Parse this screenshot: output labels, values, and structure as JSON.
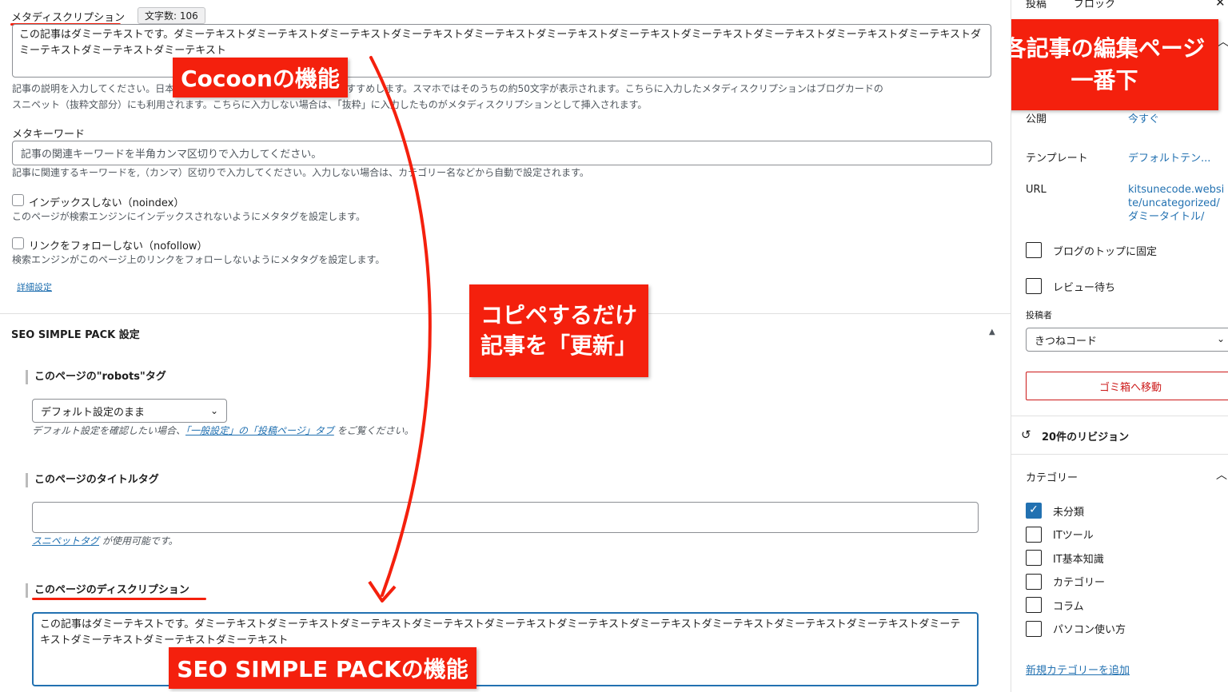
{
  "meta_description": {
    "label": "メタディスクリプション",
    "char_count": "文字数: 106",
    "value": "この記事はダミーテキストです。ダミーテキストダミーテキストダミーテキストダミーテキストダミーテキストダミーテキストダミーテキストダミーテキストダミーテキストダミーテキストダミーテキストダミーテキストダミーテキストダミーテキスト",
    "help_line1": "記事の説明を入力してください。日本語では、およそ120文字前後の入力をおすすめします。スマホではそのうちの約50文字が表示されます。こちらに入力したメタディスクリプションはブログカードの",
    "help_line2": "スニペット（抜粋文部分）にも利用されます。こちらに入力しない場合は、「抜粋」に入力したものがメタディスクリプションとして挿入されます。"
  },
  "meta_keywords": {
    "label": "メタキーワード",
    "placeholder": "記事の関連キーワードを半角カンマ区切りで入力してください。",
    "help": "記事に関連するキーワードを,（カンマ）区切りで入力してください。入力しない場合は、カテゴリー名などから自動で設定されます。"
  },
  "noindex": {
    "label": "インデックスしない（noindex）",
    "help": "このページが検索エンジンにインデックスされないようにメタタグを設定します。"
  },
  "nofollow": {
    "label": "リンクをフォローしない（nofollow）",
    "help": "検索エンジンがこのページ上のリンクをフォローしないようにメタタグを設定します。"
  },
  "detail_link": "詳細設定",
  "ssp": {
    "title": "SEO SIMPLE PACK 設定",
    "robots_heading": "このページの\"robots\"タグ",
    "robots_select": "デフォルト設定のまま",
    "robots_help_pre": "デフォルト設定を確認したい場合、",
    "robots_help_link": "「一般設定」の「投稿ページ」タブ",
    "robots_help_post": "をご覧ください。",
    "title_heading": "このページのタイトルタグ",
    "title_help_link": "スニペットタグ",
    "title_help_post": "が使用可能です。",
    "desc_heading": "このページのディスクリプション",
    "desc_value": "この記事はダミーテキストです。ダミーテキストダミーテキストダミーテキストダミーテキストダミーテキストダミーテキストダミーテキストダミーテキストダミーテキストダミーテキストダミーテキストダミーテキストダミーテキストダミーテキスト"
  },
  "annotations": {
    "cocoon": "Cocoonの機能",
    "copy_line1": "コピペするだけ",
    "copy_line2": "記事を「更新」",
    "ssp_feature": "SEO SIMPLE PACKの機能",
    "bottom_line1": "各記事の編集ページ",
    "bottom_line2": "一番下"
  },
  "sidebar": {
    "tab_post": "投稿",
    "tab_block": "ブロック",
    "publish_label": "公開",
    "publish_value": "今すぐ",
    "template_label": "テンプレート",
    "template_value": "デフォルトテン...",
    "url_label": "URL",
    "url_value1": "kitsunecode.websi",
    "url_value2": "te/uncategorized/",
    "url_value3": "ダミータイトル/",
    "sticky_label": "ブログのトップに固定",
    "pending_label": "レビュー待ち",
    "author_label": "投稿者",
    "author_value": "きつねコード",
    "trash_button": "ゴミ箱へ移動",
    "revisions": "20件のリビジョン",
    "categories_title": "カテゴリー",
    "categories": [
      {
        "name": "未分類",
        "checked": true
      },
      {
        "name": "ITツール",
        "checked": false
      },
      {
        "name": "IT基本知識",
        "checked": false
      },
      {
        "name": "カテゴリー",
        "checked": false
      },
      {
        "name": "コラム",
        "checked": false
      },
      {
        "name": "パソコン使い方",
        "checked": false
      }
    ],
    "add_category": "新規カテゴリーを追加"
  },
  "colors": {
    "annotation_red": "#f4200d",
    "link_blue": "#2271b1",
    "trash_red": "#cc1818"
  }
}
